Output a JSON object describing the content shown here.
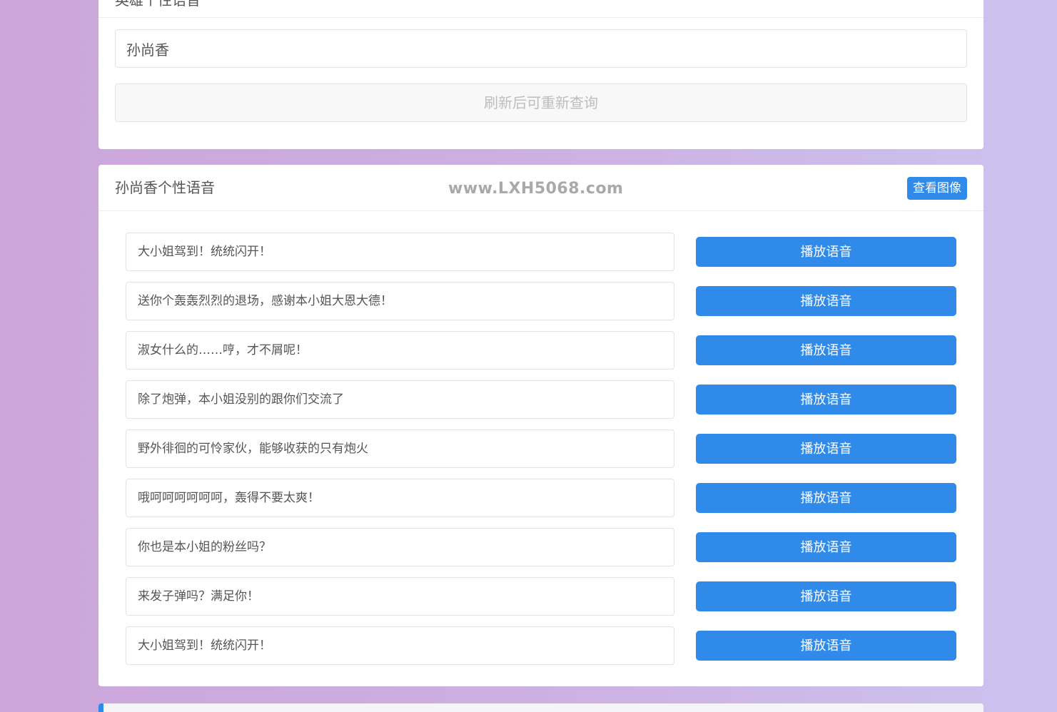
{
  "query": {
    "title": "英雄个性语音",
    "input_value": "孙尚香",
    "refresh_label": "刷新后可重新查询"
  },
  "voices": {
    "title": "孙尚香个性语音",
    "watermark": "www.LXH5068.com",
    "view_image_label": "查看图像",
    "play_label": "播放语音",
    "items": [
      {
        "text": "大小姐驾到！统统闪开！"
      },
      {
        "text": "送你个轰轰烈烈的退场，感谢本小姐大恩大德！"
      },
      {
        "text": "淑女什么的……哼，才不屑呢！"
      },
      {
        "text": "除了炮弹，本小姐没别的跟你们交流了"
      },
      {
        "text": "野外徘徊的可怜家伙，能够收获的只有炮火"
      },
      {
        "text": "哦呵呵呵呵呵呵，轰得不要太爽！"
      },
      {
        "text": "你也是本小姐的粉丝吗？"
      },
      {
        "text": "来发子弹吗？满足你！"
      },
      {
        "text": "大小姐驾到！统统闪开！"
      }
    ]
  },
  "colors": {
    "accent": "#2f8ae9",
    "background_left": "#cba6da",
    "background_right": "#ccc2f0"
  }
}
